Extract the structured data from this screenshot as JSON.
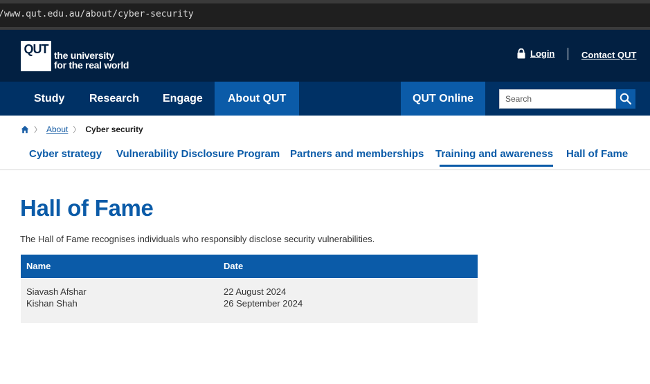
{
  "browser": {
    "url": "/www.qut.edu.au/about/cyber-security"
  },
  "header": {
    "logo_mark": "QUT",
    "logo_line1": "the university",
    "logo_line2": "for the real world",
    "login_label": "Login",
    "contact_label": "Contact QUT"
  },
  "nav": {
    "items": [
      {
        "label": "Study"
      },
      {
        "label": "Research"
      },
      {
        "label": "Engage"
      },
      {
        "label": "About QUT"
      }
    ],
    "online_label": "QUT Online",
    "search_placeholder": "Search"
  },
  "breadcrumb": {
    "link": "About",
    "current": "Cyber security"
  },
  "subnav": {
    "items": [
      {
        "label": "Cyber strategy"
      },
      {
        "label": "Vulnerability Disclosure Program"
      },
      {
        "label": "Partners and memberships"
      },
      {
        "label": "Training and awareness"
      },
      {
        "label": "Hall of Fame"
      }
    ]
  },
  "page": {
    "title": "Hall of Fame",
    "intro": "The Hall of Fame recognises individuals who responsibly disclose security vulnerabilities."
  },
  "table": {
    "headers": [
      "Name",
      "Date"
    ],
    "rows": [
      {
        "names": [
          "Siavash Afshar",
          "Kishan Shah"
        ],
        "dates": [
          "22 August 2024",
          "26 September 2024"
        ]
      }
    ]
  },
  "colors": {
    "header_bg": "#022042",
    "nav_bg": "#003165",
    "accent": "#0b5ba8"
  }
}
